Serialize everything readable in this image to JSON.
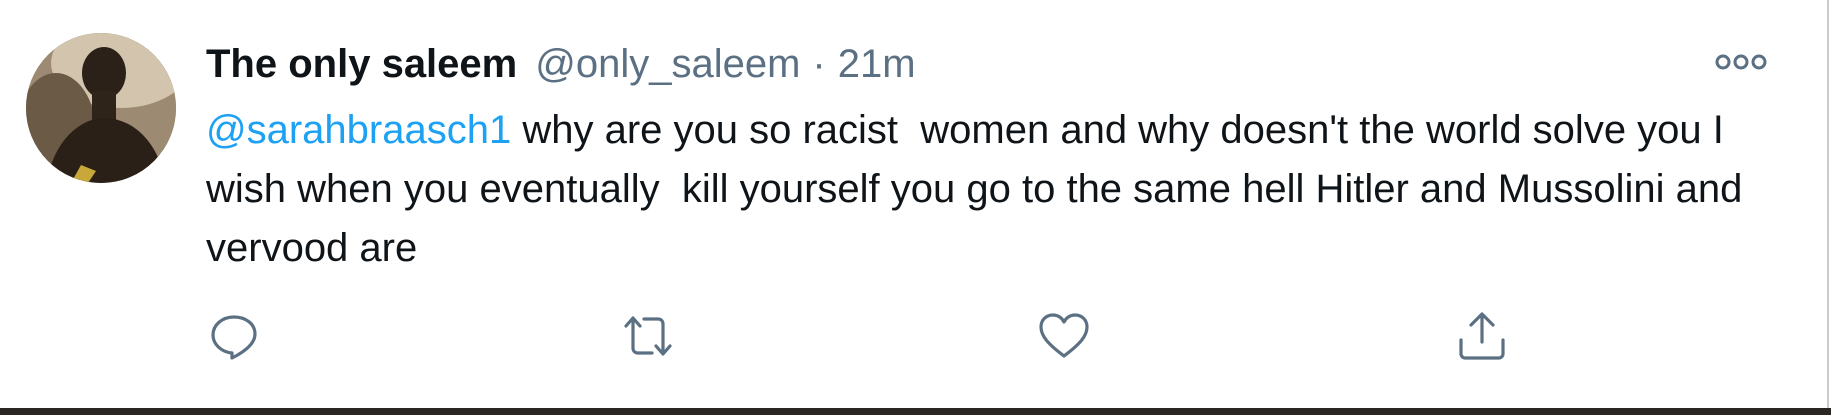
{
  "tweet": {
    "display_name": "The only saleem",
    "handle": "@only_saleem",
    "separator": "·",
    "timestamp": "21m",
    "mention": "@sarahbraasch1",
    "text": " why are you so racist  women and why doesn't the world solve you I wish when you eventually  kill yourself you go to the same hell Hitler and Mussolini and vervood are"
  },
  "icons": {
    "more": "more-options-icon",
    "reply": "reply-icon",
    "retweet": "retweet-icon",
    "like": "like-icon",
    "share": "share-icon"
  },
  "colors": {
    "text": "#0f1419",
    "secondary": "#5b7083",
    "link": "#1da1f2"
  }
}
